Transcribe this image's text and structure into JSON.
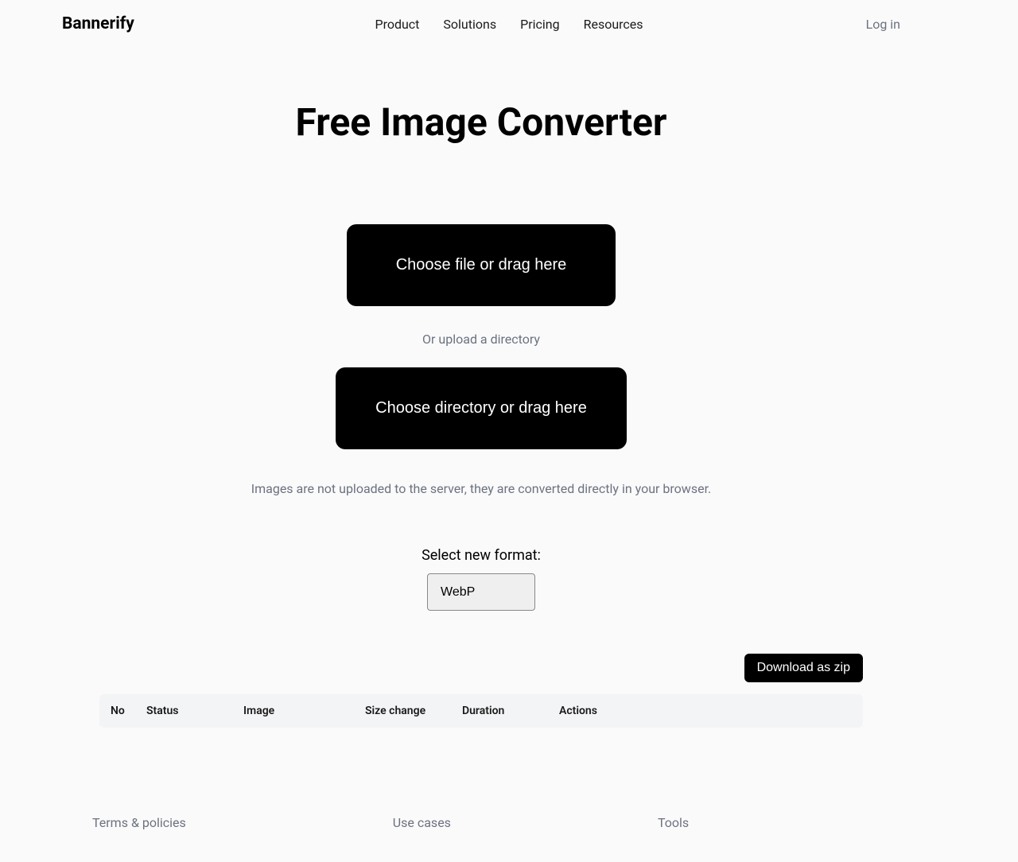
{
  "header": {
    "logo": "Bannerify",
    "nav": {
      "product": "Product",
      "solutions": "Solutions",
      "pricing": "Pricing",
      "resources": "Resources"
    },
    "login": "Log in"
  },
  "main": {
    "title": "Free Image Converter",
    "upload_file_btn": "Choose file or drag here",
    "or_text": "Or upload a directory",
    "upload_dir_btn": "Choose directory or drag here",
    "info_text": "Images are not uploaded to the server, they are converted directly in your browser.",
    "format_label": "Select new format:",
    "format_selected": "WebP",
    "download_btn": "Download as zip",
    "table_headers": {
      "no": "No",
      "status": "Status",
      "image": "Image",
      "size_change": "Size change",
      "duration": "Duration",
      "actions": "Actions"
    }
  },
  "footer": {
    "terms": "Terms & policies",
    "use_cases": "Use cases",
    "tools": "Tools"
  }
}
